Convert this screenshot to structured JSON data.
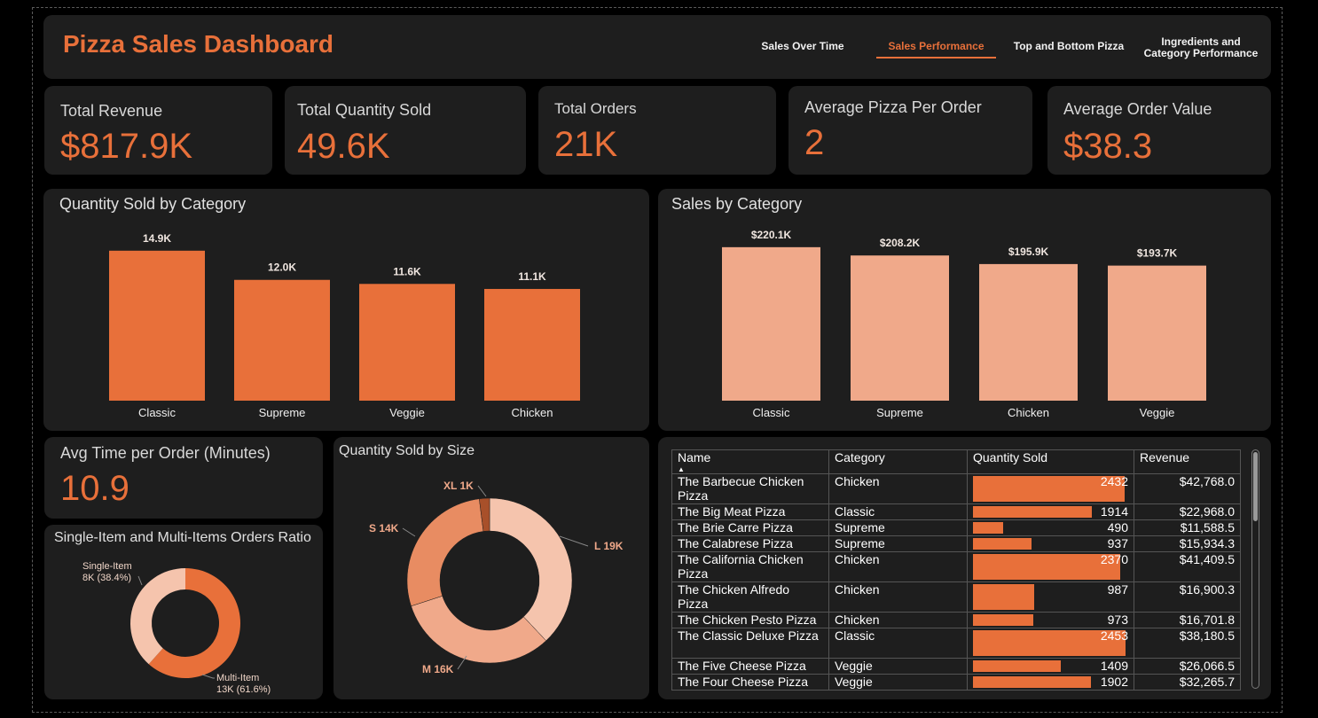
{
  "header": {
    "title": "Pizza Sales Dashboard",
    "nav": [
      {
        "label": "Sales Over Time",
        "active": false
      },
      {
        "label": "Sales Performance",
        "active": true
      },
      {
        "label": "Top and Bottom Pizza",
        "active": false
      },
      {
        "label": "Ingredients and Category Performance",
        "active": false
      }
    ]
  },
  "kpis": [
    {
      "label": "Total Revenue",
      "value": "$817.9K"
    },
    {
      "label": "Total Quantity Sold",
      "value": "49.6K"
    },
    {
      "label": "Total Orders",
      "value": "21K"
    },
    {
      "label": "Average Pizza Per Order",
      "value": "2"
    },
    {
      "label": "Average Order Value",
      "value": "$38.3"
    }
  ],
  "avg_time": {
    "label": "Avg Time per Order (Minutes)",
    "value": "10.9"
  },
  "colors": {
    "accent": "#e8703a",
    "light": "#f0a98a",
    "panel": "#1e1e1e",
    "lightest": "#f5c4ad"
  },
  "chart_data": [
    {
      "type": "bar",
      "title": "Quantity Sold by Category",
      "categories": [
        "Classic",
        "Supreme",
        "Veggie",
        "Chicken"
      ],
      "values": [
        14.9,
        12.0,
        11.6,
        11.1
      ],
      "labels": [
        "14.9K",
        "12.0K",
        "11.6K",
        "11.1K"
      ],
      "ylim": [
        0,
        15.5
      ]
    },
    {
      "type": "bar",
      "title": "Sales by Category",
      "categories": [
        "Classic",
        "Supreme",
        "Chicken",
        "Veggie"
      ],
      "values": [
        220.1,
        208.2,
        195.9,
        193.7
      ],
      "labels": [
        "$220.1K",
        "$208.2K",
        "$195.9K",
        "$193.7K"
      ],
      "ylim": [
        0,
        225
      ]
    },
    {
      "type": "pie",
      "title": "Quantity Sold by Size",
      "slices": [
        {
          "name": "L",
          "value": 19,
          "label": "L 19K"
        },
        {
          "name": "M",
          "value": 16,
          "label": "M 16K"
        },
        {
          "name": "S",
          "value": 14,
          "label": "S 14K"
        },
        {
          "name": "XL",
          "value": 1,
          "label": "XL 1K"
        }
      ]
    },
    {
      "type": "pie",
      "title": "Single-Item and Multi-Items Orders Ratio",
      "slices": [
        {
          "name": "Multi-Item",
          "value": 61.6,
          "label_line1": "Multi-Item",
          "label_line2": "13K (61.6%)"
        },
        {
          "name": "Single-Item",
          "value": 38.4,
          "label_line1": "Single-Item",
          "label_line2": "8K (38.4%)"
        }
      ]
    }
  ],
  "table": {
    "columns": [
      "Name",
      "Category",
      "Quantity Sold",
      "Revenue"
    ],
    "qty_max": 2453,
    "rows": [
      {
        "name": "The Barbecue Chicken Pizza",
        "category": "Chicken",
        "qty": 2432,
        "revenue": "$42,768.0",
        "lines": 2
      },
      {
        "name": "The Big Meat Pizza",
        "category": "Classic",
        "qty": 1914,
        "revenue": "$22,968.0",
        "lines": 1
      },
      {
        "name": "The Brie Carre Pizza",
        "category": "Supreme",
        "qty": 490,
        "revenue": "$11,588.5",
        "lines": 1
      },
      {
        "name": "The Calabrese Pizza",
        "category": "Supreme",
        "qty": 937,
        "revenue": "$15,934.3",
        "lines": 1
      },
      {
        "name": "The California Chicken Pizza",
        "category": "Chicken",
        "qty": 2370,
        "revenue": "$41,409.5",
        "lines": 2
      },
      {
        "name": "The Chicken Alfredo Pizza",
        "category": "Chicken",
        "qty": 987,
        "revenue": "$16,900.3",
        "lines": 2
      },
      {
        "name": "The Chicken Pesto Pizza",
        "category": "Chicken",
        "qty": 973,
        "revenue": "$16,701.8",
        "lines": 1
      },
      {
        "name": "The Classic Deluxe Pizza",
        "category": "Classic",
        "qty": 2453,
        "revenue": "$38,180.5",
        "lines": 2
      },
      {
        "name": "The Five Cheese Pizza",
        "category": "Veggie",
        "qty": 1409,
        "revenue": "$26,066.5",
        "lines": 1
      },
      {
        "name": "The Four Cheese Pizza",
        "category": "Veggie",
        "qty": 1902,
        "revenue": "$32,265.7",
        "lines": 1
      }
    ]
  }
}
